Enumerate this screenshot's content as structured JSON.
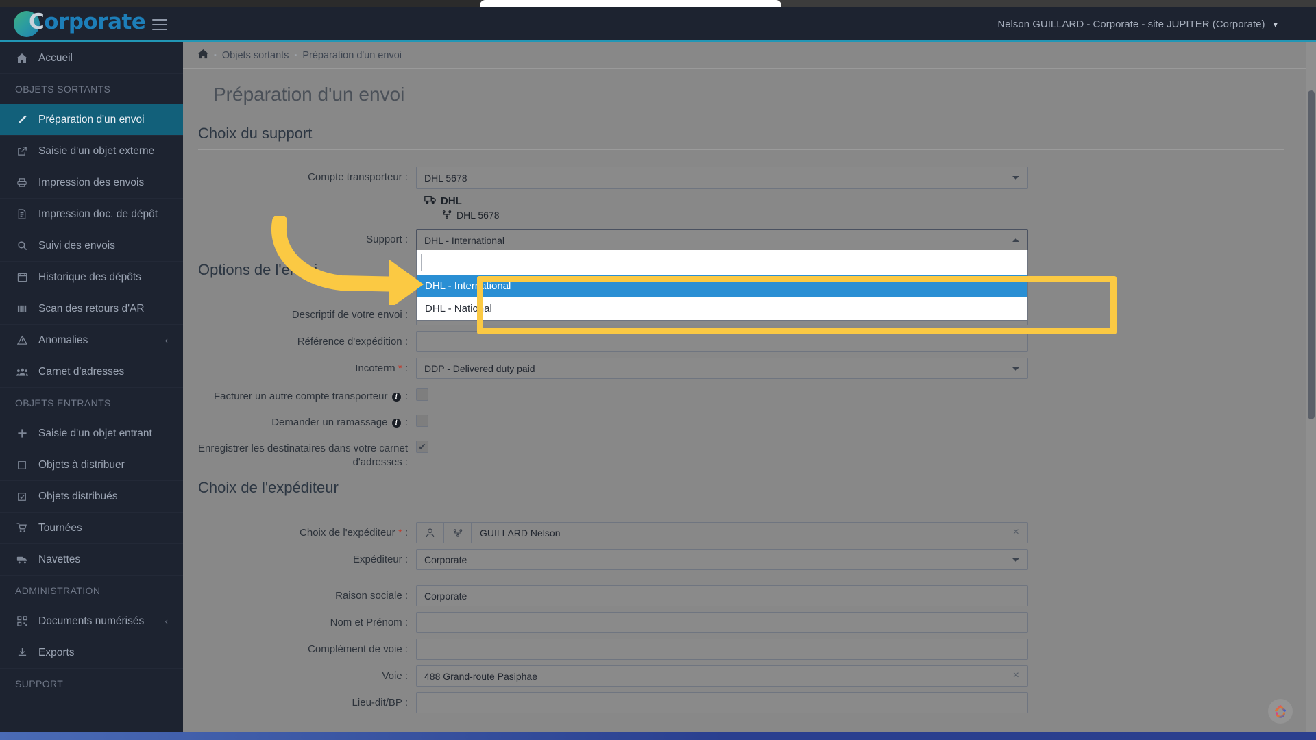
{
  "navbar": {
    "brand_letter": "C",
    "brand_text": "orporate",
    "menu_icon": "hamburger-icon",
    "user_label": "Nelson GUILLARD - Corporate - site JUPITER (Corporate)",
    "user_caret": "▾",
    "accent_color": "#2196b5",
    "brand_blue": "#1d7eb8"
  },
  "sidebar": {
    "home": {
      "label": "Accueil",
      "icon": "home-icon"
    },
    "groups": [
      {
        "heading": "OBJETS SORTANTS",
        "items": [
          {
            "label": "Préparation d'un envoi",
            "icon": "pencil-icon",
            "active": true,
            "arrow": ""
          },
          {
            "label": "Saisie d'un objet externe",
            "icon": "external-link-icon",
            "active": false,
            "arrow": ""
          },
          {
            "label": "Impression des envois",
            "icon": "printer-icon",
            "active": false,
            "arrow": ""
          },
          {
            "label": "Impression doc. de dépôt",
            "icon": "document-icon",
            "active": false,
            "arrow": ""
          },
          {
            "label": "Suivi des envois",
            "icon": "search-icon",
            "active": false,
            "arrow": ""
          },
          {
            "label": "Historique des dépôts",
            "icon": "calendar-icon",
            "active": false,
            "arrow": ""
          },
          {
            "label": "Scan des retours d'AR",
            "icon": "barcode-icon",
            "active": false,
            "arrow": ""
          },
          {
            "label": "Anomalies",
            "icon": "warning-triangle-icon",
            "active": false,
            "arrow": "‹"
          },
          {
            "label": "Carnet d'adresses",
            "icon": "users-icon",
            "active": false,
            "arrow": ""
          }
        ]
      },
      {
        "heading": "OBJETS ENTRANTS",
        "items": [
          {
            "label": "Saisie d'un objet entrant",
            "icon": "plus-icon",
            "active": false,
            "arrow": ""
          },
          {
            "label": "Objets à distribuer",
            "icon": "square-icon",
            "active": false,
            "arrow": ""
          },
          {
            "label": "Objets distribués",
            "icon": "check-square-icon",
            "active": false,
            "arrow": ""
          },
          {
            "label": "Tournées",
            "icon": "cart-icon",
            "active": false,
            "arrow": ""
          },
          {
            "label": "Navettes",
            "icon": "truck-icon",
            "active": false,
            "arrow": ""
          }
        ]
      },
      {
        "heading": "ADMINISTRATION",
        "items": [
          {
            "label": "Documents numérisés",
            "icon": "qrcode-icon",
            "active": false,
            "arrow": "‹"
          },
          {
            "label": "Exports",
            "icon": "download-icon",
            "active": false,
            "arrow": ""
          }
        ]
      },
      {
        "heading": "SUPPORT",
        "items": []
      }
    ]
  },
  "breadcrumb": {
    "home_icon": "home-icon",
    "items": [
      "Objets sortants",
      "Préparation d'un envoi"
    ],
    "separator": "▪"
  },
  "page": {
    "title": "Préparation d'un envoi"
  },
  "sections": {
    "support": {
      "title": "Choix du support",
      "carrier_account": {
        "label": "Compte transporteur :",
        "value": "DHL 5678",
        "caret": "▾"
      },
      "carrier_info": {
        "icon": "truck-icon",
        "name": "DHL",
        "account_icon": "network-icon",
        "account": "DHL 5678"
      },
      "support_field": {
        "label": "Support :",
        "value": "DHL - International",
        "caret": "▴"
      },
      "dropdown": {
        "search_value": "",
        "options": [
          {
            "label": "DHL - International",
            "selected": true
          },
          {
            "label": "DHL - National",
            "selected": false
          }
        ]
      }
    },
    "options": {
      "title": "Options de l'envoi",
      "rows": [
        {
          "label": "Descriptif de votre envoi :",
          "value": "",
          "type": "text",
          "required": false,
          "info": false
        },
        {
          "label": "Référence d'expédition :",
          "value": "",
          "type": "text",
          "required": false,
          "info": false
        },
        {
          "label": "Incoterm",
          "value": "DDP - Delivered duty paid",
          "type": "select",
          "required": true,
          "info": false
        },
        {
          "label": "Facturer un autre compte transporteur",
          "value": "",
          "type": "checkbox",
          "checked": false,
          "required": false,
          "info": true
        },
        {
          "label": "Demander un ramassage",
          "value": "",
          "type": "checkbox",
          "checked": false,
          "required": false,
          "info": true
        },
        {
          "label": "Enregistrer les destinataires dans votre carnet d'adresses :",
          "value": "",
          "type": "checkbox",
          "checked": true,
          "required": false,
          "info": false
        }
      ],
      "check_glyph": "✔"
    },
    "sender": {
      "title": "Choix de l'expéditeur",
      "choice": {
        "label": "Choix de l'expéditeur",
        "required": true,
        "icon_person": "person-icon",
        "icon_network": "network-icon",
        "value": "GUILLARD Nelson",
        "clear": "×"
      },
      "expediteur": {
        "label": "Expéditeur :",
        "value": "Corporate",
        "caret": "▾"
      },
      "fields": [
        {
          "label": "Raison sociale :",
          "value": "Corporate",
          "clearable": false
        },
        {
          "label": "Nom et Prénom :",
          "value": "",
          "clearable": false
        },
        {
          "label": "Complément de voie :",
          "value": "",
          "clearable": false
        },
        {
          "label": "Voie :",
          "value": "488 Grand-route Pasiphae",
          "clearable": true
        },
        {
          "label": "Lieu-dit/BP :",
          "value": "",
          "clearable": false
        }
      ],
      "clear_glyph": "×"
    }
  },
  "annotation": {
    "highlight_color": "#fbc943",
    "arrow_color": "#fbc943",
    "target": "DHL - International"
  },
  "widgets": {
    "fab_icon": "chat-widget-icon"
  },
  "colors": {
    "sidebar_bg": "#1d2330",
    "active_item": "#12607a",
    "content_bg": "#888888",
    "dropdown_selected": "#2a8fd4",
    "required_star": "#c0392b"
  }
}
